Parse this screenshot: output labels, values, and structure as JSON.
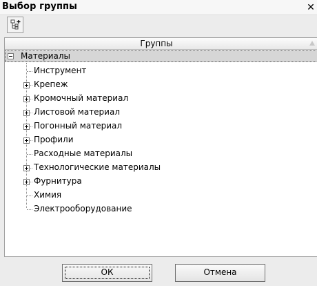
{
  "window": {
    "title": "Выбор группы",
    "close_glyph": "✕"
  },
  "toolbar": {
    "add_group_icon": "tree-add-icon"
  },
  "tree": {
    "column_header": "Группы",
    "root": {
      "label": "Материалы",
      "expanded": true,
      "selected": true
    },
    "items": [
      {
        "label": "Инструмент",
        "expandable": false
      },
      {
        "label": "Крепеж",
        "expandable": true
      },
      {
        "label": "Кромочный материал",
        "expandable": true
      },
      {
        "label": "Листовой материал",
        "expandable": true
      },
      {
        "label": "Погонный материал",
        "expandable": true
      },
      {
        "label": "Профили",
        "expandable": true
      },
      {
        "label": "Расходные материалы",
        "expandable": false
      },
      {
        "label": "Технологические материалы",
        "expandable": true
      },
      {
        "label": "Фурнитура",
        "expandable": true
      },
      {
        "label": "Химия",
        "expandable": false
      },
      {
        "label": "Электрооборудование",
        "expandable": false
      }
    ]
  },
  "footer": {
    "ok_label": "ОК",
    "cancel_label": "Отмена"
  }
}
